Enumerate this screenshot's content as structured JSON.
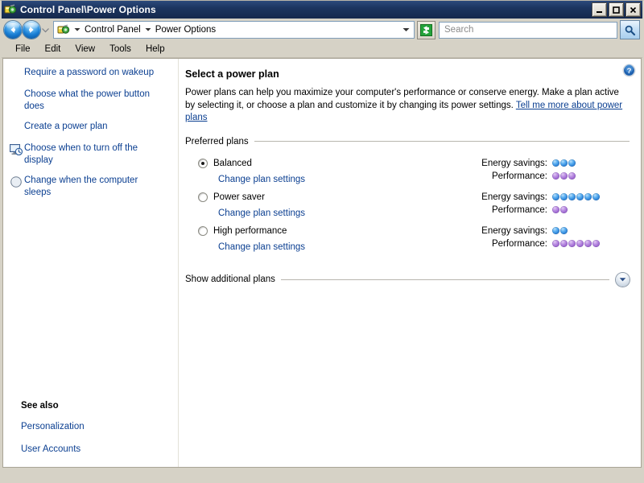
{
  "window": {
    "title": "Control Panel\\Power Options",
    "icon": "power-plug-icon",
    "minimize_label": "Minimize",
    "maximize_label": "Maximize",
    "close_label": "Close"
  },
  "navbar": {
    "back_label": "Back",
    "forward_label": "Forward",
    "recent_pages_label": "Recent Pages",
    "address_icon": "power-plug-icon",
    "breadcrumbs": [
      "Control Panel",
      "Power Options"
    ],
    "address_dropdown_label": "Previous Locations",
    "refresh_label": "Refresh",
    "search_placeholder": "Search",
    "search_value": "",
    "search_button_label": "Search"
  },
  "menubar": {
    "items": [
      "File",
      "Edit",
      "View",
      "Tools",
      "Help"
    ]
  },
  "sidebar": {
    "tasks": [
      {
        "label": "Require a password on wakeup",
        "icon": ""
      },
      {
        "label": "Choose what the power button does",
        "icon": ""
      },
      {
        "label": "Create a power plan",
        "icon": ""
      },
      {
        "label": "Choose when to turn off the display",
        "icon": "monitor-clock-icon"
      },
      {
        "label": "Change when the computer sleeps",
        "icon": "sleep-moon-icon"
      }
    ],
    "see_also": {
      "title": "See also",
      "links": [
        "Personalization",
        "User Accounts"
      ]
    }
  },
  "content": {
    "help_label": "Help",
    "heading": "Select a power plan",
    "description_part1": "Power plans can help you maximize your computer's performance or conserve energy. Make a plan active by selecting it, or choose a plan and customize it by changing its power settings. ",
    "description_link": "Tell me more about power plans",
    "preferred_plans_label": "Preferred plans",
    "energy_label": "Energy savings:",
    "performance_label": "Performance:",
    "change_settings_label": "Change plan settings",
    "plans": [
      {
        "name": "Balanced",
        "selected": true,
        "energy_dots": 3,
        "performance_dots": 3
      },
      {
        "name": "Power saver",
        "selected": false,
        "energy_dots": 6,
        "performance_dots": 2
      },
      {
        "name": "High performance",
        "selected": false,
        "energy_dots": 2,
        "performance_dots": 6
      }
    ],
    "show_additional_label": "Show additional plans",
    "expand_label": "Expand"
  },
  "colors": {
    "titlebar": "#1c3560",
    "link": "#0b3f91",
    "chrome": "#d6d2c6",
    "energy_dot": "#2a7fd6",
    "performance_dot": "#9a64cf"
  }
}
